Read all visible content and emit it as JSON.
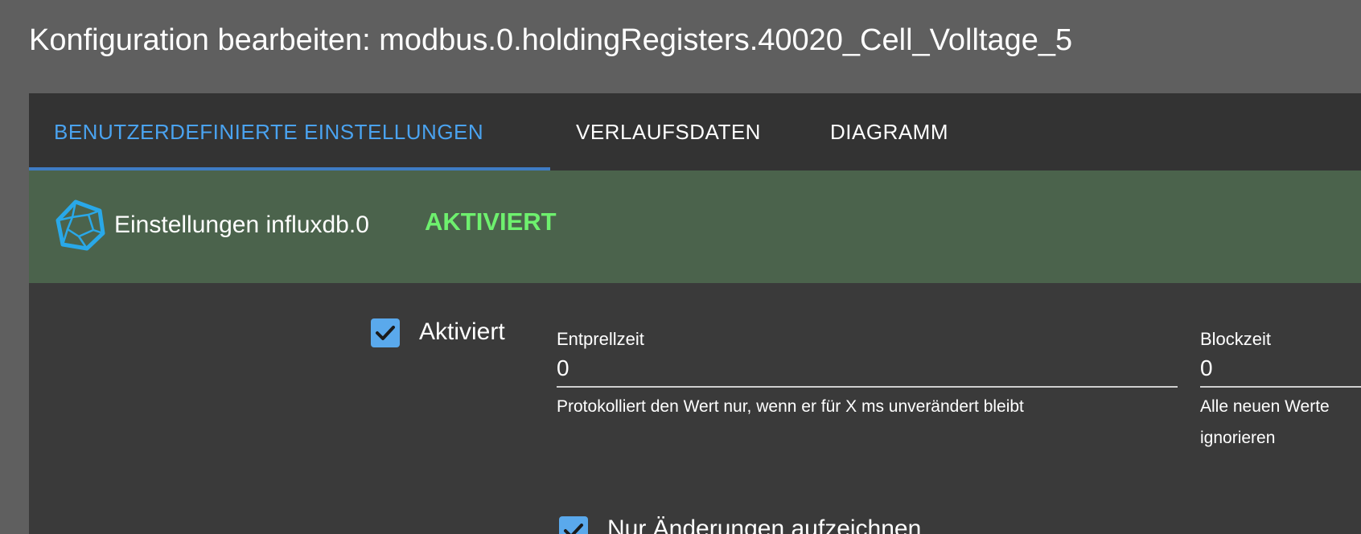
{
  "page_title": "Konfiguration bearbeiten: modbus.0.holdingRegisters.40020_Cell_Volltage_5",
  "tabs": [
    {
      "label": "Benutzerdefinierte Einstellungen",
      "active": true
    },
    {
      "label": "Verlaufsdaten",
      "active": false
    },
    {
      "label": "Diagramm",
      "active": false
    }
  ],
  "banner": {
    "icon": "influxdb-polyhedron-icon",
    "title": "Einstellungen influxdb.0",
    "status": "AKTIVIERT"
  },
  "settings": {
    "enabled": {
      "label": "Aktiviert",
      "checked": true
    },
    "debounce": {
      "label": "Entprellzeit",
      "value": "0",
      "helper": "Protokolliert den Wert nur, wenn er für X ms unverändert bleibt"
    },
    "blocktime": {
      "label": "Blockzeit",
      "value": "0",
      "helper": "Alle neuen Werte ignorieren"
    },
    "changes_only": {
      "label": "Nur Änderungen aufzeichnen",
      "checked": true
    }
  },
  "colors": {
    "accent": "#4aa3f0",
    "tab_indicator": "#3f7cc4",
    "banner_bg": "#4b634c",
    "status_active": "#6ef06e",
    "checkbox": "#5aa9ec",
    "icon": "#29a8e8"
  }
}
